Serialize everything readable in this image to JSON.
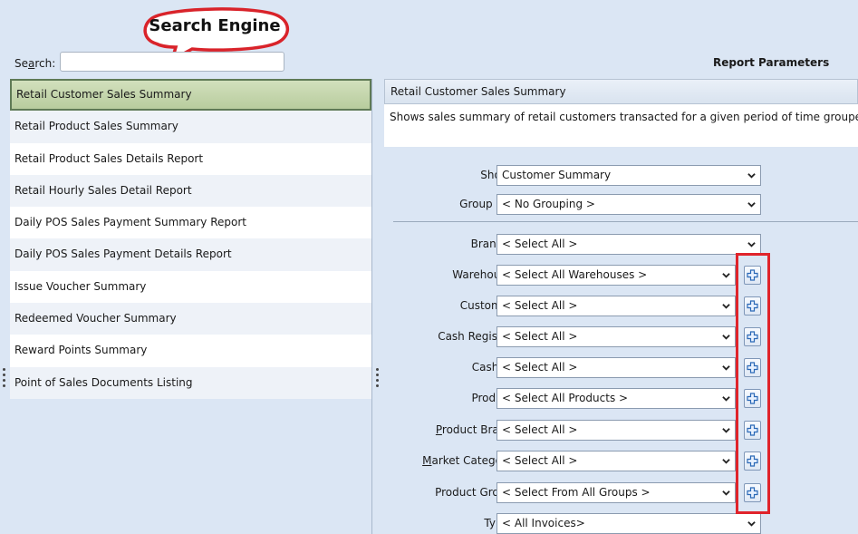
{
  "callout": {
    "title": "Search Engine"
  },
  "search": {
    "label_prefix": "Se",
    "label_accel": "a",
    "label_suffix": "rch:",
    "value": ""
  },
  "report_parameters_title": "Report Parameters",
  "reports": [
    {
      "label": "Retail Customer Sales Summary",
      "selected": true
    },
    {
      "label": "Retail Product Sales Summary"
    },
    {
      "label": "Retail Product Sales Details Report"
    },
    {
      "label": "Retail Hourly Sales Detail Report"
    },
    {
      "label": "Daily POS Sales Payment Summary Report"
    },
    {
      "label": "Daily POS Sales Payment Details Report"
    },
    {
      "label": "Issue Voucher Summary"
    },
    {
      "label": "Redeemed Voucher Summary"
    },
    {
      "label": "Reward Points Summary"
    },
    {
      "label": "Point of Sales Documents Listing"
    }
  ],
  "selected_report": {
    "title": "Retail Customer Sales Summary",
    "description": "Shows sales summary of retail customers transacted for a given period of time groupe"
  },
  "params": {
    "show": {
      "label": "Show:",
      "value": "Customer Summary"
    },
    "group_by": {
      "label": "Group By:",
      "value": "< No Grouping >"
    },
    "branch": {
      "label": "Branch:",
      "value": "< Select All >"
    },
    "warehouse": {
      "label": "Warehouse",
      "value": "< Select All Warehouses >"
    },
    "customer": {
      "label": "Customer",
      "value": "< Select All >"
    },
    "cash_register": {
      "label": "Cash Register",
      "value": "< Select All >"
    },
    "cashier": {
      "label": "Cashier",
      "value": "< Select All >"
    },
    "product": {
      "label": "Product",
      "value": "< Select All Products >"
    },
    "product_brand": {
      "label_accel": "P",
      "label_rest": "roduct Brand",
      "value": "< Select All >"
    },
    "market_category": {
      "label_accel": "M",
      "label_rest": "arket Category",
      "value": "< Select All >"
    },
    "product_group": {
      "label": "Product Group",
      "value": "< Select From All Groups >"
    },
    "type": {
      "label": "Type:",
      "value": "< All Invoices>"
    }
  },
  "colors": {
    "selected_row": "#c6d8ad",
    "highlight_box": "#e0242b",
    "callout_outline": "#d9232a",
    "panel_bg": "#dbe6f4"
  },
  "icons": {
    "dropdown": "chevron-down-icon",
    "add": "plus-icon"
  }
}
